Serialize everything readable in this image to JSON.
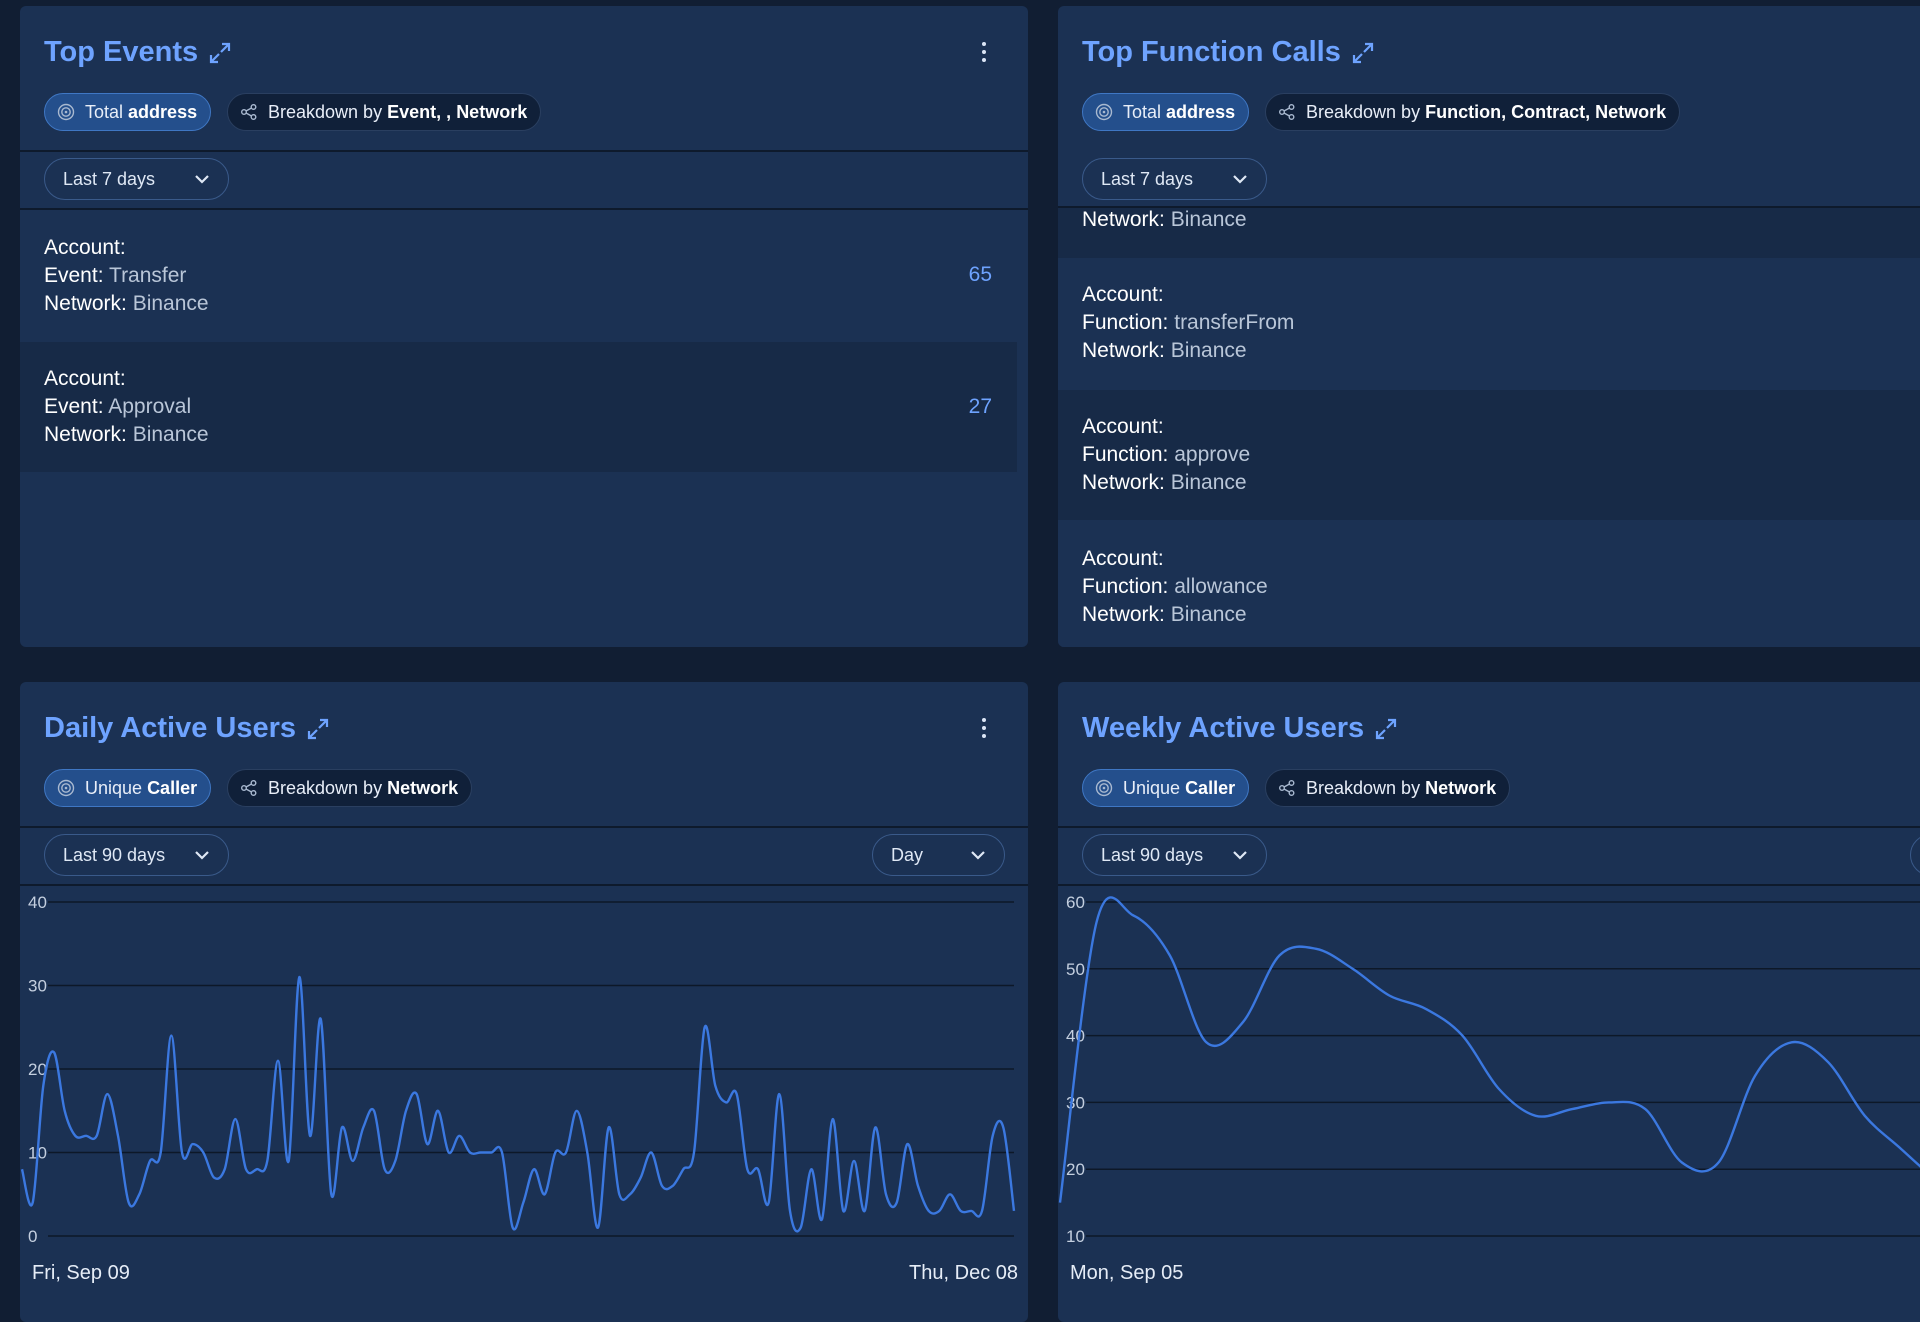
{
  "colors": {
    "accent": "#6ea3ff",
    "card": "#1b3153",
    "line": "#3b78e0"
  },
  "top_events": {
    "title": "Top Events",
    "metric": {
      "prefix": "Total",
      "bold": "address"
    },
    "breakdown": {
      "prefix": "Breakdown by",
      "parts": [
        "Event",
        ",",
        "Network"
      ],
      "separator": ","
    },
    "range": "Last 7 days",
    "rows": [
      {
        "l1": "Account:",
        "k2": "Event:",
        "v2": "Transfer",
        "k3": "Network:",
        "v3": "Binance",
        "value": "65"
      },
      {
        "l1": "Account:",
        "k2": "Event:",
        "v2": "Approval",
        "k3": "Network:",
        "v3": "Binance",
        "value": "27"
      }
    ]
  },
  "top_functions": {
    "title": "Top Function Calls",
    "metric": {
      "prefix": "Total",
      "bold": "address"
    },
    "breakdown": {
      "prefix": "Breakdown by",
      "parts": [
        "Function",
        "Contract",
        "Network"
      ],
      "separator": ","
    },
    "range": "Last 7 days",
    "partial_row": {
      "k": "Network:",
      "v": "Binance"
    },
    "rows": [
      {
        "l1": "Account:",
        "k2": "Function:",
        "v2": "transferFrom",
        "k3": "Network:",
        "v3": "Binance"
      },
      {
        "l1": "Account:",
        "k2": "Function:",
        "v2": "approve",
        "k3": "Network:",
        "v3": "Binance"
      },
      {
        "l1": "Account:",
        "k2": "Function:",
        "v2": "allowance",
        "k3": "Network:",
        "v3": "Binance"
      }
    ]
  },
  "daily_active": {
    "title": "Daily Active Users",
    "metric": {
      "prefix": "Unique",
      "bold": "Caller"
    },
    "breakdown": {
      "prefix": "Breakdown by",
      "bold": "Network"
    },
    "range": "Last 90 days",
    "granularity": "Day",
    "x_start": "Fri, Sep 09",
    "x_end": "Thu, Dec 08"
  },
  "weekly_active": {
    "title": "Weekly Active Users",
    "metric": {
      "prefix": "Unique",
      "bold": "Caller"
    },
    "breakdown": {
      "prefix": "Breakdown by",
      "bold": "Network"
    },
    "range": "Last 90 days",
    "x_start": "Mon, Sep 05"
  },
  "chart_data": [
    {
      "type": "line",
      "title": "Daily Active Users",
      "xlabel": "",
      "ylabel": "",
      "ylim": [
        0,
        40
      ],
      "yticks": [
        "0",
        "10",
        "20",
        "30",
        "40"
      ],
      "x_tick_labels": [
        "Fri, Sep 09",
        "Thu, Dec 08"
      ],
      "grid": true,
      "series": [
        {
          "values": [
            8,
            4,
            18,
            22,
            15,
            12,
            12,
            12,
            17,
            12,
            4,
            5,
            9,
            10,
            24,
            10,
            11,
            10,
            7,
            8,
            14,
            8,
            8,
            9,
            21,
            9,
            31,
            12,
            26,
            5,
            13,
            9,
            13,
            15,
            8,
            9,
            15,
            17,
            11,
            15,
            10,
            12,
            10,
            10,
            10,
            10,
            1,
            4,
            8,
            5,
            10,
            10,
            15,
            10,
            1,
            13,
            5,
            5,
            7,
            10,
            6,
            6,
            8,
            10,
            25,
            18,
            16,
            17,
            8,
            8,
            4,
            17,
            3,
            1,
            8,
            2,
            14,
            3,
            9,
            3,
            13,
            5,
            4,
            11,
            6,
            3,
            3,
            5,
            3,
            3,
            3,
            12,
            13,
            3
          ]
        }
      ]
    },
    {
      "type": "line",
      "title": "Weekly Active Users",
      "xlabel": "",
      "ylabel": "",
      "ylim": [
        10,
        60
      ],
      "yticks": [
        "10",
        "20",
        "30",
        "40",
        "50",
        "60"
      ],
      "x_tick_labels": [
        "Mon, Sep 05"
      ],
      "grid": true,
      "series": [
        {
          "values": [
            15,
            57,
            58,
            52,
            39,
            42,
            52,
            53,
            50,
            46,
            44,
            40,
            32,
            28,
            29,
            30,
            29,
            21,
            21,
            34,
            39,
            36,
            28,
            23,
            18
          ]
        }
      ]
    }
  ]
}
